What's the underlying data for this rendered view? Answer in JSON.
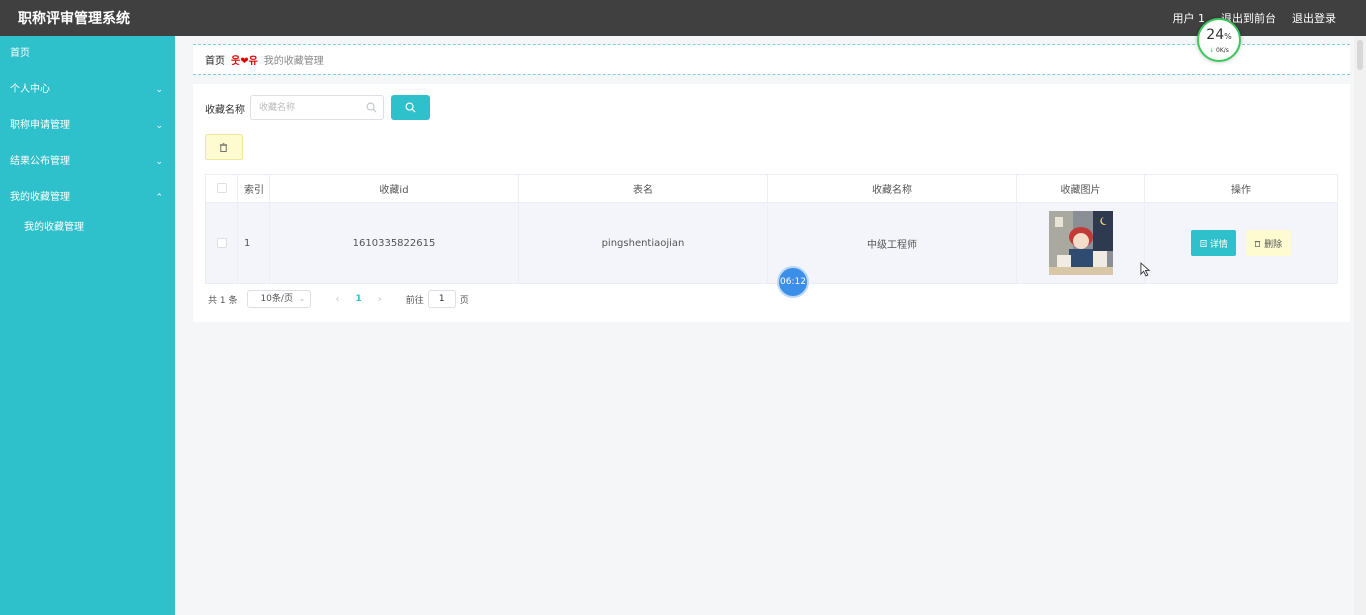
{
  "app": {
    "title": "职称评审管理系统"
  },
  "topbar": {
    "user_label": "用户 1",
    "front_label": "退出到前台",
    "logout_label": "退出登录"
  },
  "sidebar": {
    "items": [
      {
        "label": "首页"
      },
      {
        "label": "个人中心"
      },
      {
        "label": "职称申请管理"
      },
      {
        "label": "结果公布管理"
      },
      {
        "label": "我的收藏管理"
      }
    ],
    "sub_items": [
      {
        "label": "我的收藏管理"
      }
    ]
  },
  "breadcrumb": {
    "home": "首页",
    "separator": "웃❤유",
    "current": "我的收藏管理"
  },
  "search": {
    "label": "收藏名称",
    "placeholder": "收藏名称",
    "value": ""
  },
  "table": {
    "headers": {
      "index": "索引",
      "id": "收藏id",
      "table_name": "表名",
      "name": "收藏名称",
      "image": "收藏图片",
      "actions": "操作"
    },
    "rows": [
      {
        "index": "1",
        "id": "1610335822615",
        "table_name": "pingshentiaojian",
        "name": "中级工程师",
        "detail_label": "详情",
        "delete_label": "删除"
      }
    ]
  },
  "pagination": {
    "total": "共 1 条",
    "page_size": "10条/页",
    "current_page": "1",
    "goto_label": "前往",
    "goto_value": "1",
    "page_unit": "页"
  },
  "overlays": {
    "speed_percent": "24",
    "speed_percent_unit": "%",
    "speed_rate": "0K/s",
    "timer": "06:12"
  },
  "colors": {
    "accent": "#2ec0cb",
    "topbar": "#404040",
    "warning_bg": "#fffbd0"
  }
}
